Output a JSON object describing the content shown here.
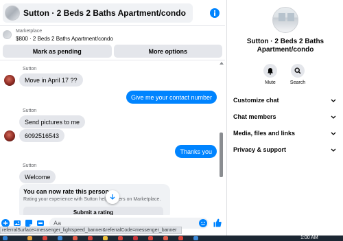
{
  "header": {
    "title": "Sutton · 2 Beds 2 Baths Apartment/condo",
    "info_icon": "info-icon"
  },
  "listing": {
    "source": "Marketplace",
    "detail": "$800 · 2 Beds 2 Baths Apartment/condo"
  },
  "actions": {
    "pending": "Mark as pending",
    "more": "More options"
  },
  "messages": [
    {
      "sender": "Sutton",
      "text": "Move in April 17 ??"
    },
    {
      "text": "Give me your contact number"
    },
    {
      "sender": "Sutton",
      "text": "Send pictures to me"
    },
    {
      "text": "6092516543"
    },
    {
      "text": "Thanks you"
    },
    {
      "sender": "Sutton",
      "text": "Welcome"
    }
  ],
  "rate": {
    "title": "You can now rate this person",
    "description": "Rating your experience with Sutton helps others on Marketplace.",
    "button": "Submit a rating"
  },
  "composer": {
    "placeholder": "Aa"
  },
  "details": {
    "title": "Sutton · 2 Beds 2 Baths Apartment/condo",
    "mute": "Mute",
    "search": "Search",
    "sections": [
      "Customize chat",
      "Chat members",
      "Media, files and links",
      "Privacy & support"
    ]
  },
  "status_url": "referralSurface=messenger_lightspeed_banner&referralCode=messenger_banner",
  "taskbar": {
    "clock": "1:00 AM"
  },
  "colors": {
    "accent": "#0084ff",
    "bubble_in": "#e4e6eb",
    "taskbar": "#1c2733"
  }
}
